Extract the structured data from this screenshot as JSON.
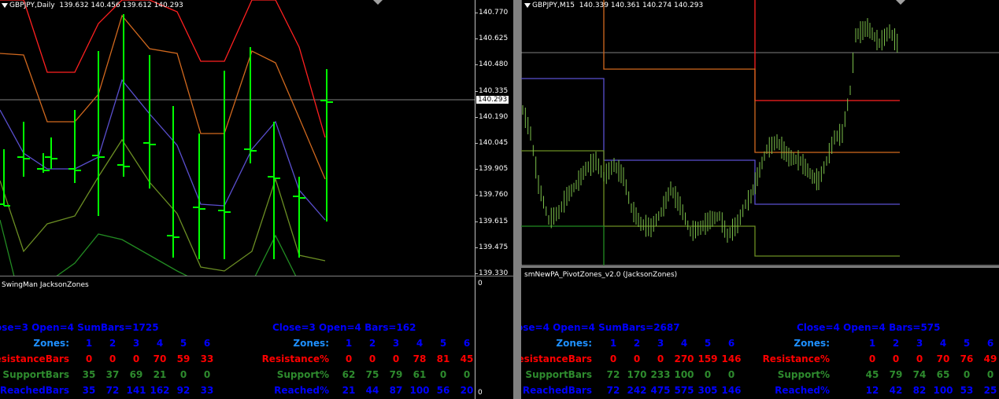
{
  "colors": {
    "blue": "#0000ff",
    "lightblue": "#1e90ff",
    "red": "#ff0000",
    "green": "#2e8b2e",
    "candle": "#00ff00",
    "band_red": "#ff2020",
    "band_orange": "#d2691e",
    "band_purple": "#5a4fcf",
    "band_olive": "#6b8e23",
    "band_green": "#228b22"
  },
  "left": {
    "chart_title": "GBPJPY,Daily",
    "ohlc": "139.632 140.456 139.612 140.293",
    "price_ticks": [
      "140.770",
      "140.625",
      "140.480",
      "140.335",
      "140.190",
      "140.045",
      "139.905",
      "139.760",
      "139.615",
      "139.475",
      "139.330"
    ],
    "current_price": "140.293",
    "indicator_title": "SwingMan JacksonZones",
    "ind_axis": {
      "top": "0",
      "bottom": "0"
    },
    "stats_a": {
      "header": "ose=3  Open=4   SumBars=1725",
      "zones_label": "Zones:",
      "zones": [
        "1",
        "2",
        "3",
        "4",
        "5",
        "6"
      ],
      "res_label": "ResistanceBars",
      "res": [
        "0",
        "0",
        "0",
        "70",
        "59",
        "33"
      ],
      "sup_label": "SupportBars",
      "sup": [
        "35",
        "37",
        "69",
        "21",
        "0",
        "0"
      ],
      "reach_label": "ReachedBars",
      "reach": [
        "35",
        "72",
        "141",
        "162",
        "92",
        "33"
      ]
    },
    "stats_b": {
      "header": "Close=3  Open=4   Bars=162",
      "zones_label": "Zones:",
      "zones": [
        "1",
        "2",
        "3",
        "4",
        "5",
        "6"
      ],
      "res_label": "Resistance%",
      "res": [
        "0",
        "0",
        "0",
        "78",
        "81",
        "45"
      ],
      "sup_label": "Support%",
      "sup": [
        "62",
        "75",
        "79",
        "61",
        "0",
        "0"
      ],
      "reach_label": "Reached%",
      "reach": [
        "21",
        "44",
        "87",
        "100",
        "56",
        "20"
      ]
    }
  },
  "right": {
    "chart_title": "GBPJPY,M15",
    "ohlc": "140.339 140.361 140.274 140.293",
    "indicator_title": "smNewPA_PivotZones_v2.0 (JacksonZones)",
    "stats_a": {
      "header": "ose=4  Open=4   SumBars=2687",
      "zones_label": "Zones:",
      "zones": [
        "1",
        "2",
        "3",
        "4",
        "5",
        "6"
      ],
      "res_label": "ResistanceBars",
      "res": [
        "0",
        "0",
        "0",
        "270",
        "159",
        "146"
      ],
      "sup_label": "SupportBars",
      "sup": [
        "72",
        "170",
        "233",
        "100",
        "0",
        "0"
      ],
      "reach_label": "ReachedBars",
      "reach": [
        "72",
        "242",
        "475",
        "575",
        "305",
        "146"
      ]
    },
    "stats_b": {
      "header": "Close=4  Open=4   Bars=575",
      "zones_label": "Zones:",
      "zones": [
        "1",
        "2",
        "3",
        "4",
        "5",
        "6"
      ],
      "res_label": "Resistance%",
      "res": [
        "0",
        "0",
        "0",
        "70",
        "76",
        "49"
      ],
      "sup_label": "Support%",
      "sup": [
        "45",
        "79",
        "74",
        "65",
        "0",
        "0"
      ],
      "reach_label": "Reached%",
      "reach": [
        "12",
        "42",
        "82",
        "100",
        "53",
        "25"
      ]
    }
  }
}
